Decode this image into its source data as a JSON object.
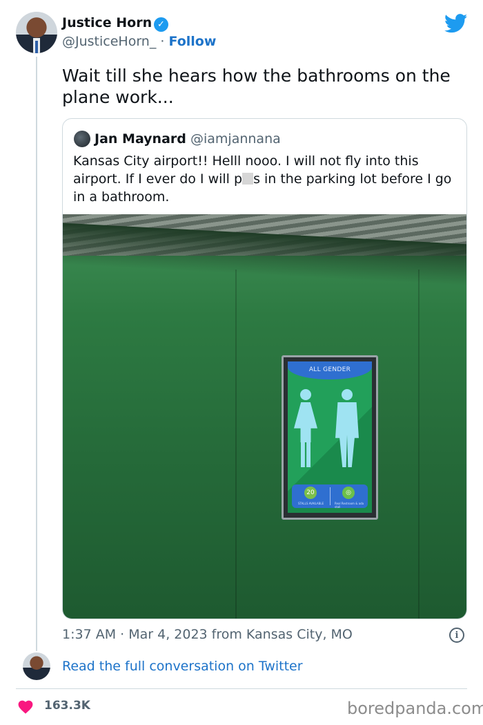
{
  "author": {
    "name": "Justice Horn",
    "handle": "@JusticeHorn_",
    "separator": "·",
    "follow_label": "Follow"
  },
  "tweet": {
    "text": "Wait till she hears how the bathrooms on the plane work..."
  },
  "quoted_tweet": {
    "name": "Jan Maynard",
    "handle": "@iamjannana",
    "text_part1": "Kansas City airport!! Helll nooo. I will not fly into this airport.  If I ever do I will p",
    "text_part2": "s in the parking lot before I go in a bathroom.",
    "image": {
      "sign_header": "ALL GENDER",
      "stalls_count": "20",
      "stalls_label": "STALLS AVAILABLE",
      "right_label": "Real Restroom & ada stall"
    }
  },
  "meta": {
    "timestamp": "1:37 AM · Mar 4, 2023 from Kansas City, MO",
    "read_link": "Read the full conversation on Twitter",
    "likes": "163.3K",
    "watermark": "boredpanda.com"
  },
  "colors": {
    "accent": "#1d9bf0",
    "link": "#1d73c9",
    "heart": "#f91880",
    "muted": "#536471"
  },
  "icons": [
    "verified-icon",
    "twitter-bird-icon",
    "info-icon",
    "heart-icon"
  ]
}
